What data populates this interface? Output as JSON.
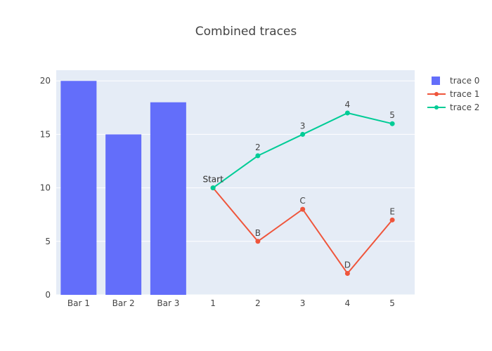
{
  "chart_data": {
    "title": "Combined traces",
    "type": "bar+line",
    "x_categories": [
      "Bar 1",
      "Bar 2",
      "Bar 3",
      "1",
      "2",
      "3",
      "4",
      "5"
    ],
    "ylim": [
      0,
      21
    ],
    "yticks": [
      0,
      5,
      10,
      15,
      20
    ],
    "grid": true,
    "legend_position": "top-right",
    "series": [
      {
        "name": "trace 0",
        "type": "bar",
        "color": "#636efa",
        "x": [
          "Bar 1",
          "Bar 2",
          "Bar 3"
        ],
        "y": [
          20,
          15,
          18
        ]
      },
      {
        "name": "trace 1",
        "type": "line",
        "color": "#ef553b",
        "x": [
          "1",
          "2",
          "3",
          "4",
          "5"
        ],
        "y": [
          10,
          5,
          8,
          2,
          7
        ],
        "labels": [
          "Start",
          "B",
          "C",
          "D",
          "E"
        ]
      },
      {
        "name": "trace 2",
        "type": "line",
        "color": "#00cc96",
        "x": [
          "1",
          "2",
          "3",
          "4",
          "5"
        ],
        "y": [
          10,
          13,
          15,
          17,
          16
        ],
        "labels": [
          "Start",
          "2",
          "3",
          "4",
          "5"
        ]
      }
    ]
  },
  "colors": {
    "plot_bg": "#e5ecf6",
    "grid": "#ffffff",
    "text": "#444444"
  }
}
